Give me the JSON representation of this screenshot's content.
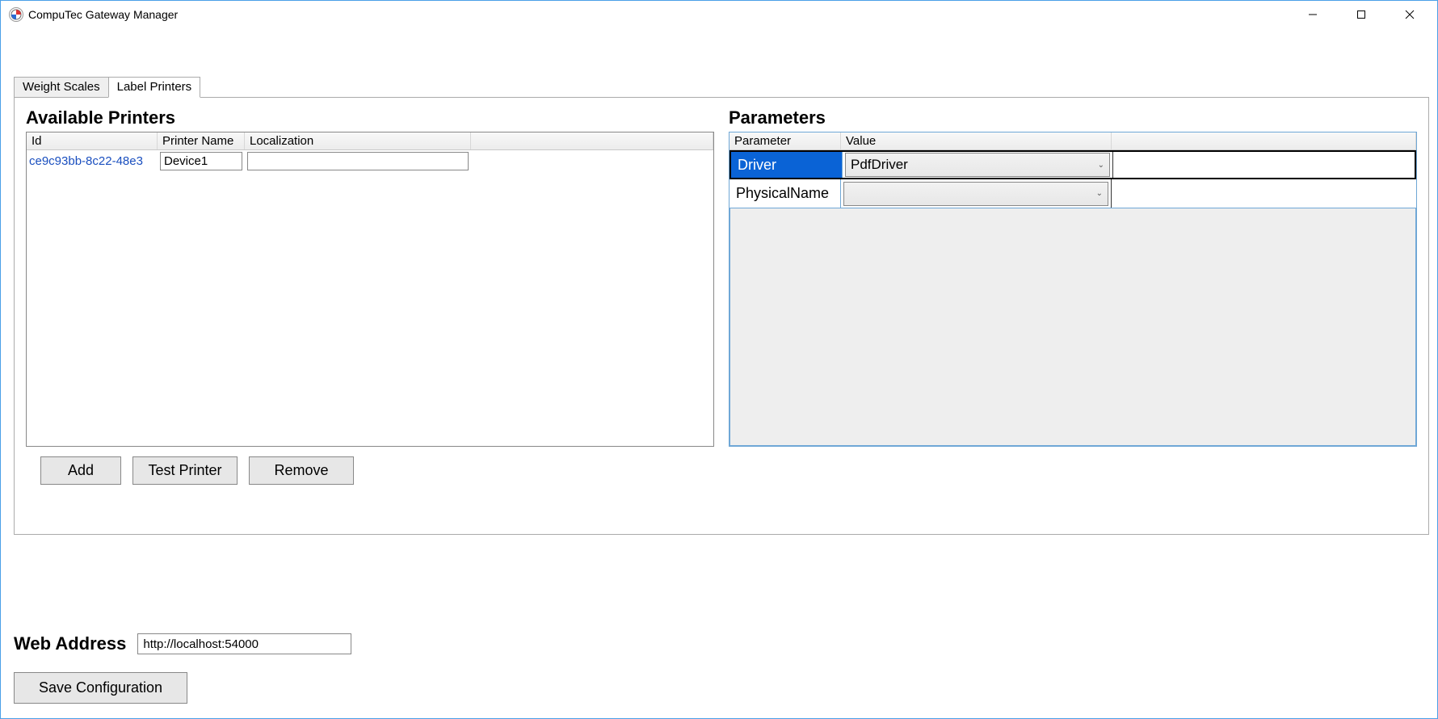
{
  "window": {
    "title": "CompuTec Gateway Manager"
  },
  "tabs": [
    {
      "label": "Weight Scales",
      "active": false
    },
    {
      "label": "Label Printers",
      "active": true
    }
  ],
  "leftPanel": {
    "title": "Available Printers",
    "columns": {
      "id": "Id",
      "name": "Printer Name",
      "loc": "Localization"
    },
    "rows": [
      {
        "id": "ce9c93bb-8c22-48e3",
        "name": "Device1",
        "localization": ""
      }
    ],
    "buttons": {
      "add": "Add",
      "test": "Test Printer",
      "remove": "Remove"
    }
  },
  "rightPanel": {
    "title": "Parameters",
    "columns": {
      "param": "Parameter",
      "value": "Value"
    },
    "rows": [
      {
        "param": "Driver",
        "value": "PdfDriver",
        "selected": true
      },
      {
        "param": "PhysicalName",
        "value": "",
        "selected": false
      }
    ]
  },
  "footer": {
    "addressLabel": "Web Address",
    "addressValue": "http://localhost:54000",
    "saveLabel": "Save Configuration"
  }
}
